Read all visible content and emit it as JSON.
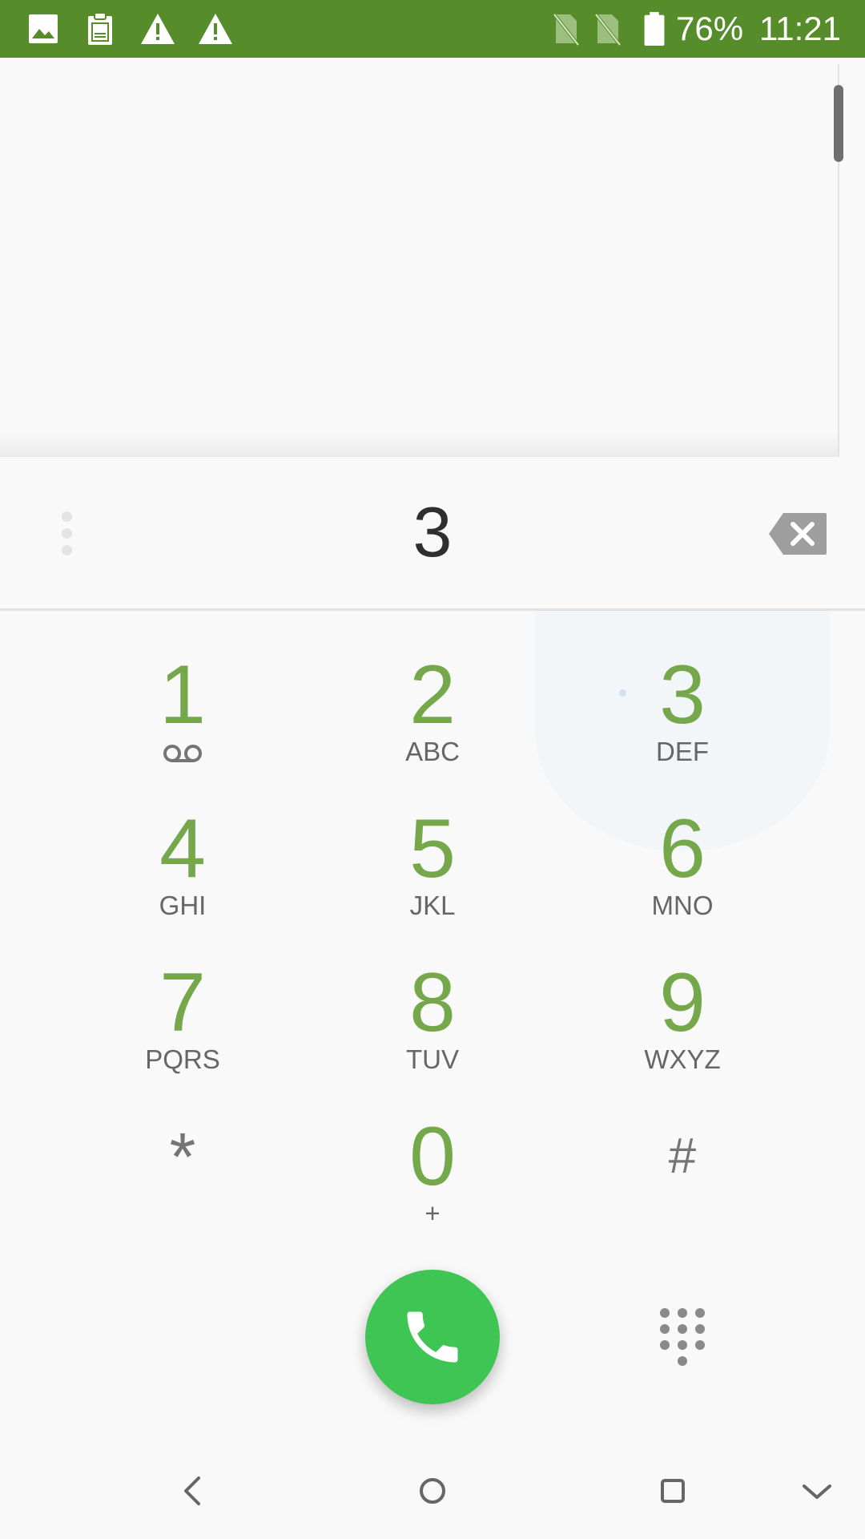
{
  "status_bar": {
    "battery_percent": "76%",
    "time": "11:21",
    "background_color": "#568d2a",
    "left_icons": [
      "image-icon",
      "log-clipboard-icon",
      "warning-icon",
      "warning-icon"
    ],
    "right_icons": [
      "no-sim-icon",
      "no-sim-icon",
      "battery-icon"
    ]
  },
  "dialer": {
    "digits": "3",
    "accent_color": "#74a84a",
    "call_button_color": "#3ec553",
    "keys": [
      {
        "digit": "1",
        "letters": "",
        "icon": "voicemail-icon"
      },
      {
        "digit": "2",
        "letters": "ABC"
      },
      {
        "digit": "3",
        "letters": "DEF"
      },
      {
        "digit": "4",
        "letters": "GHI"
      },
      {
        "digit": "5",
        "letters": "JKL"
      },
      {
        "digit": "6",
        "letters": "MNO"
      },
      {
        "digit": "7",
        "letters": "PQRS"
      },
      {
        "digit": "8",
        "letters": "TUV"
      },
      {
        "digit": "9",
        "letters": "WXYZ"
      },
      {
        "digit": "*",
        "letters": ""
      },
      {
        "digit": "0",
        "letters": "+"
      },
      {
        "digit": "#",
        "letters": ""
      }
    ]
  },
  "nav_bar": {
    "buttons": [
      "back-icon",
      "home-icon",
      "recents-icon",
      "collapse-icon"
    ]
  }
}
